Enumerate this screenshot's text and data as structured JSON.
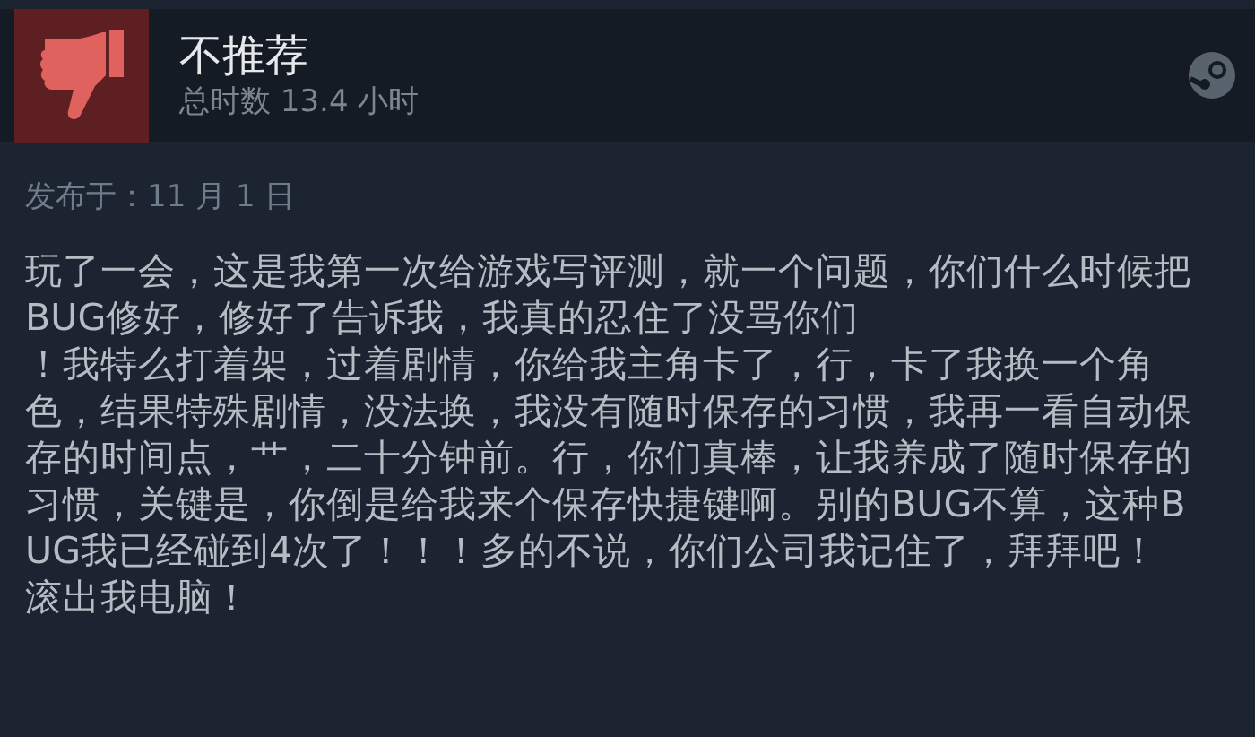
{
  "review": {
    "verdict": "不推荐",
    "hours": "总时数 13.4 小时"
  },
  "posted": "发布于：11 月 1 日",
  "paragraphs": [
    "玩了一会，这是我第一次给游戏写评测，就一个问题，你们什么时候把BUG修好，修好了告诉我，我真的忍住了没骂你们",
    "！我特么打着架，过着剧情，你给我主角卡了，行，卡了我换一个角色，结果特殊剧情，没法换，我没有随时保存的习惯，我再一看自动保存的时间点，艹，二十分钟前。行，你们真棒，让我养成了随时保存的习惯，关键是，你倒是给我来个保存快捷键啊。别的BUG不算，这种BUG我已经碰到4次了！！！多的不说，你们公司我记住了，拜拜吧！",
    "滚出我电脑！"
  ]
}
